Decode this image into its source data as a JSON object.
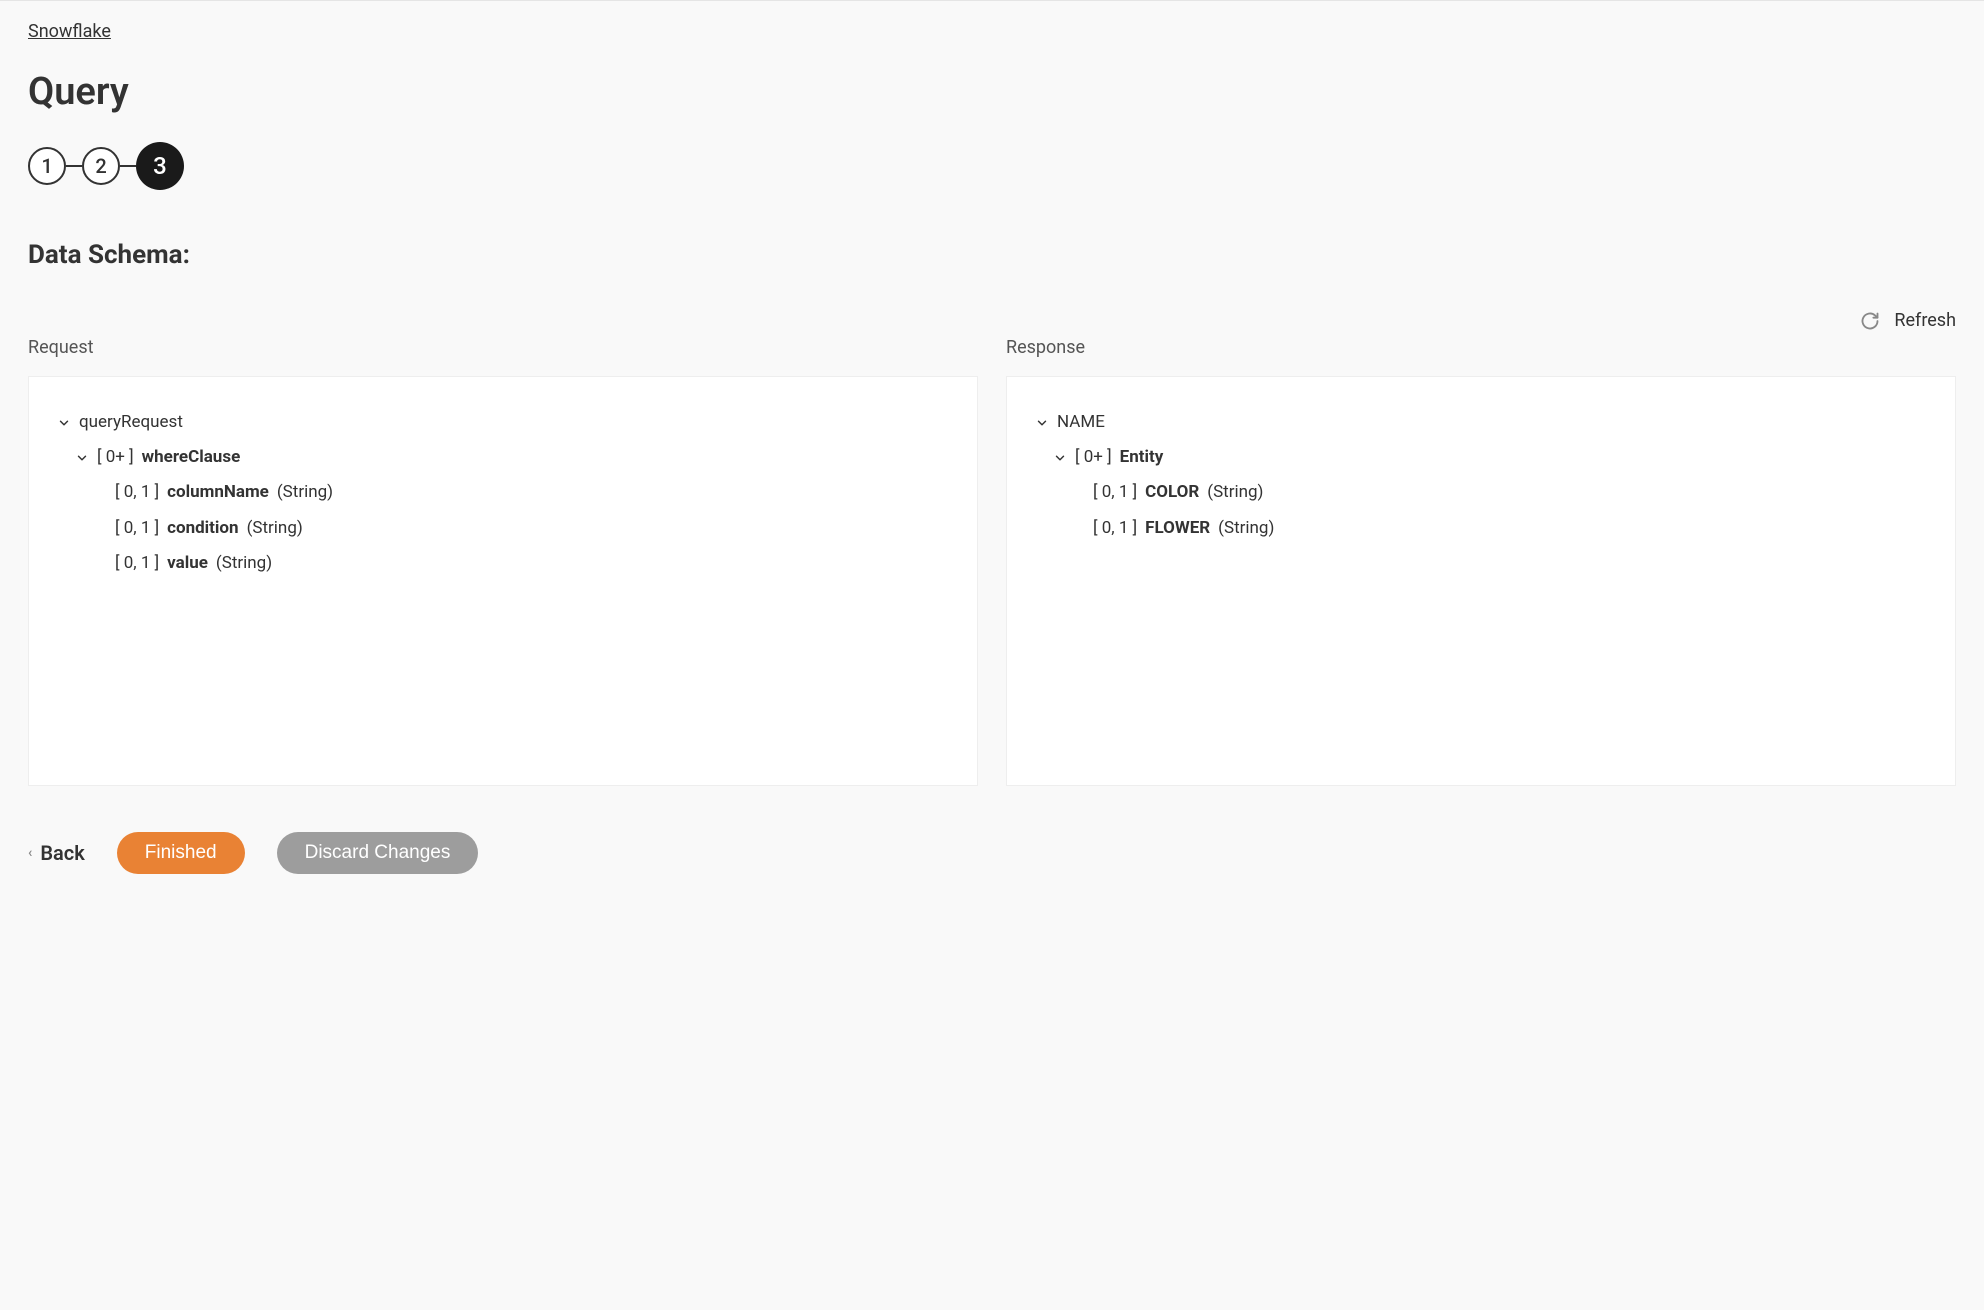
{
  "breadcrumb": "Snowflake",
  "title": "Query",
  "stepper": {
    "steps": [
      "1",
      "2",
      "3"
    ],
    "activeIndex": 2
  },
  "sectionTitle": "Data Schema:",
  "refreshLabel": "Refresh",
  "panels": {
    "request": {
      "label": "Request",
      "root": "queryRequest",
      "whereClause": {
        "cardinality": "[ 0+ ]",
        "name": "whereClause",
        "fields": [
          {
            "cardinality": "[ 0, 1 ]",
            "name": "columnName",
            "type": "(String)"
          },
          {
            "cardinality": "[ 0, 1 ]",
            "name": "condition",
            "type": "(String)"
          },
          {
            "cardinality": "[ 0, 1 ]",
            "name": "value",
            "type": "(String)"
          }
        ]
      }
    },
    "response": {
      "label": "Response",
      "root": "NAME",
      "entity": {
        "cardinality": "[ 0+ ]",
        "name": "Entity",
        "fields": [
          {
            "cardinality": "[ 0, 1 ]",
            "name": "COLOR",
            "type": "(String)"
          },
          {
            "cardinality": "[ 0, 1 ]",
            "name": "FLOWER",
            "type": "(String)"
          }
        ]
      }
    }
  },
  "footer": {
    "back": "Back",
    "finished": "Finished",
    "discard": "Discard Changes"
  }
}
